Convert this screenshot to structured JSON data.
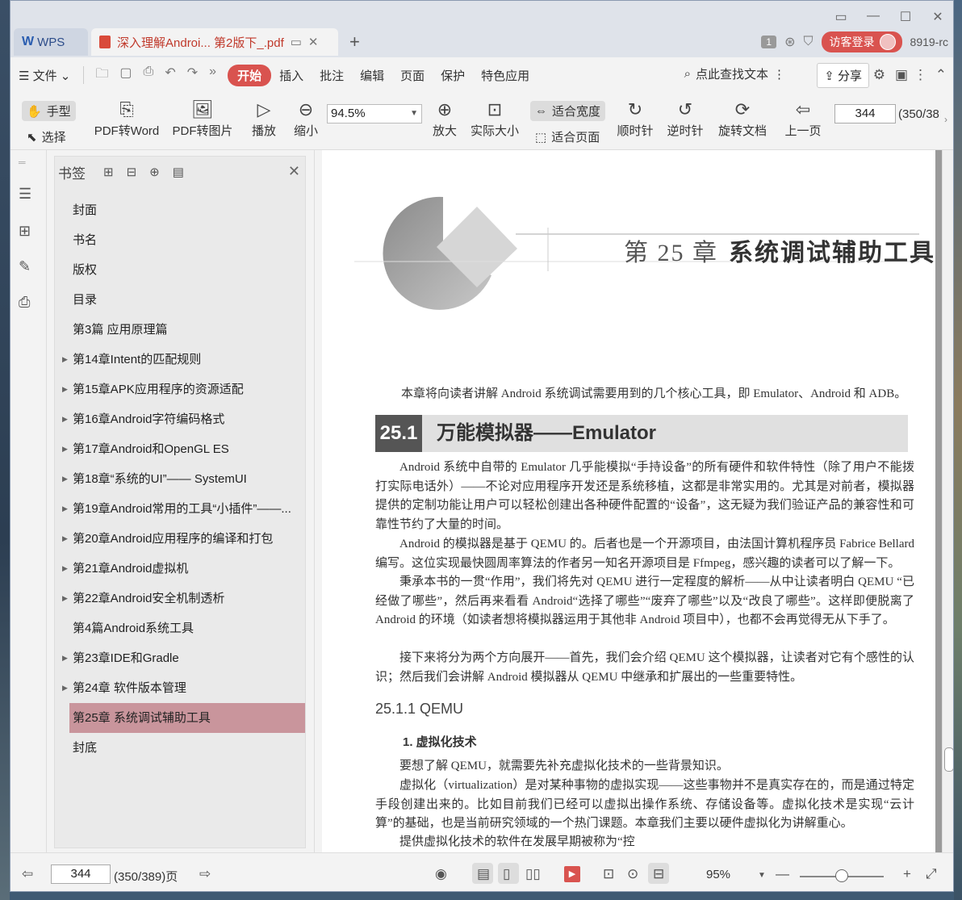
{
  "titlebar": {
    "wps_tab": "WPS",
    "doc_tab_title": "深入理解Androi... 第2版下_.pdf",
    "badge": "1",
    "login_label": "访客登录",
    "user_id": "8919-rc"
  },
  "menubar": {
    "file": "文件",
    "items": [
      "开始",
      "插入",
      "批注",
      "编辑",
      "页面",
      "保护",
      "特色应用"
    ],
    "search_label": "点此查找文本",
    "share_label": "分享"
  },
  "toolbar": {
    "hand": "手型",
    "select": "选择",
    "pdf_to_word": "PDF转Word",
    "pdf_to_image": "PDF转图片",
    "play": "播放",
    "zoom_out": "缩小",
    "zoom_value": "94.5%",
    "zoom_in": "放大",
    "actual_size": "实际大小",
    "fit_width": "适合宽度",
    "fit_page": "适合页面",
    "clockwise": "顺时针",
    "counter_clockwise": "逆时针",
    "rotate_doc": "旋转文档",
    "prev_page": "上一页",
    "page_value": "344",
    "page_total": "(350/38"
  },
  "panel": {
    "title": "书签",
    "bookmarks": [
      {
        "label": "封面",
        "expandable": false
      },
      {
        "label": "书名",
        "expandable": false
      },
      {
        "label": "版权",
        "expandable": false
      },
      {
        "label": "目录",
        "expandable": false
      },
      {
        "label": "第3篇  应用原理篇",
        "expandable": false
      },
      {
        "label": "第14章Intent的匹配规则",
        "expandable": true
      },
      {
        "label": "第15章APK应用程序的资源适配",
        "expandable": true
      },
      {
        "label": "第16章Android字符编码格式",
        "expandable": true
      },
      {
        "label": "第17章Android和OpenGL ES",
        "expandable": true
      },
      {
        "label": "第18章“系统的UI”——  SystemUI",
        "expandable": true
      },
      {
        "label": "第19章Android常用的工具“小插件”——...",
        "expandable": true
      },
      {
        "label": "第20章Android应用程序的编译和打包",
        "expandable": true
      },
      {
        "label": "第21章Android虚拟机",
        "expandable": true
      },
      {
        "label": "第22章Android安全机制透析",
        "expandable": true
      },
      {
        "label": "第4篇Android系统工具",
        "expandable": false
      },
      {
        "label": "第23章IDE和Gradle",
        "expandable": true
      },
      {
        "label": "第24章  软件版本管理",
        "expandable": true
      },
      {
        "label": "第25章  系统调试辅助工具",
        "expandable": true,
        "selected": true
      },
      {
        "label": "封底",
        "expandable": false
      }
    ]
  },
  "page": {
    "chapter_num": "第 25 章",
    "chapter_title": "系统调试辅助工具",
    "intro": "本章将向读者讲解 Android 系统调试需要用到的几个核心工具，即 Emulator、Android 和 ADB。",
    "section_num": "25.1",
    "section_title": "万能模拟器——Emulator",
    "paragraphs": [
      "Android 系统中自带的 Emulator 几乎能模拟“手持设备”的所有硬件和软件特性（除了用户不能拨打实际电话外）——不论对应用程序开发还是系统移植，这都是非常实用的。尤其是对前者，模拟器提供的定制功能让用户可以轻松创建出各种硬件配置的“设备”，这无疑为我们验证产品的兼容性和可靠性节约了大量的时间。",
      "Android 的模拟器是基于 QEMU 的。后者也是一个开源项目，由法国计算机程序员 Fabrice Bellard 编写。这位实现最快圆周率算法的作者另一知名开源项目是 Ffmpeg，感兴趣的读者可以了解一下。",
      "秉承本书的一贯“作用”，我们将先对 QEMU 进行一定程度的解析——从中让读者明白 QEMU “已经做了哪些”，然后再来看看 Android“选择了哪些”“废弃了哪些”以及“改良了哪些”。这样即便脱离了 Android 的环境（如读者想将模拟器运用于其他非 Android 项目中），也都不会再觉得无从下手了。",
      "接下来将分为两个方向展开——首先，我们会介绍 QEMU 这个模拟器，让读者对它有个感性的认识；然后我们会讲解 Android 模拟器从 QEMU 中继承和扩展出的一些重要特性。"
    ],
    "subsection": "25.1.1   QEMU",
    "subsubsection": "1.  虚拟化技术",
    "paragraphs2": [
      "要想了解 QEMU，就需要先补充虚拟化技术的一些背景知识。",
      "虚拟化（virtualization）是对某种事物的虚拟实现——这些事物并不是真实存在的，而是通过特定手段创建出来的。比如目前我们已经可以虚拟出操作系统、存储设备等。虚拟化技术是实现“云计算”的基础，也是当前研究领域的一个热门课题。本章我们主要以硬件虚拟化为讲解重心。",
      "提供虚拟化技术的软件在发展早期被称为“控"
    ]
  },
  "statusbar": {
    "page_value": "344",
    "page_total": "(350/389)页",
    "zoom_label": "95%"
  }
}
